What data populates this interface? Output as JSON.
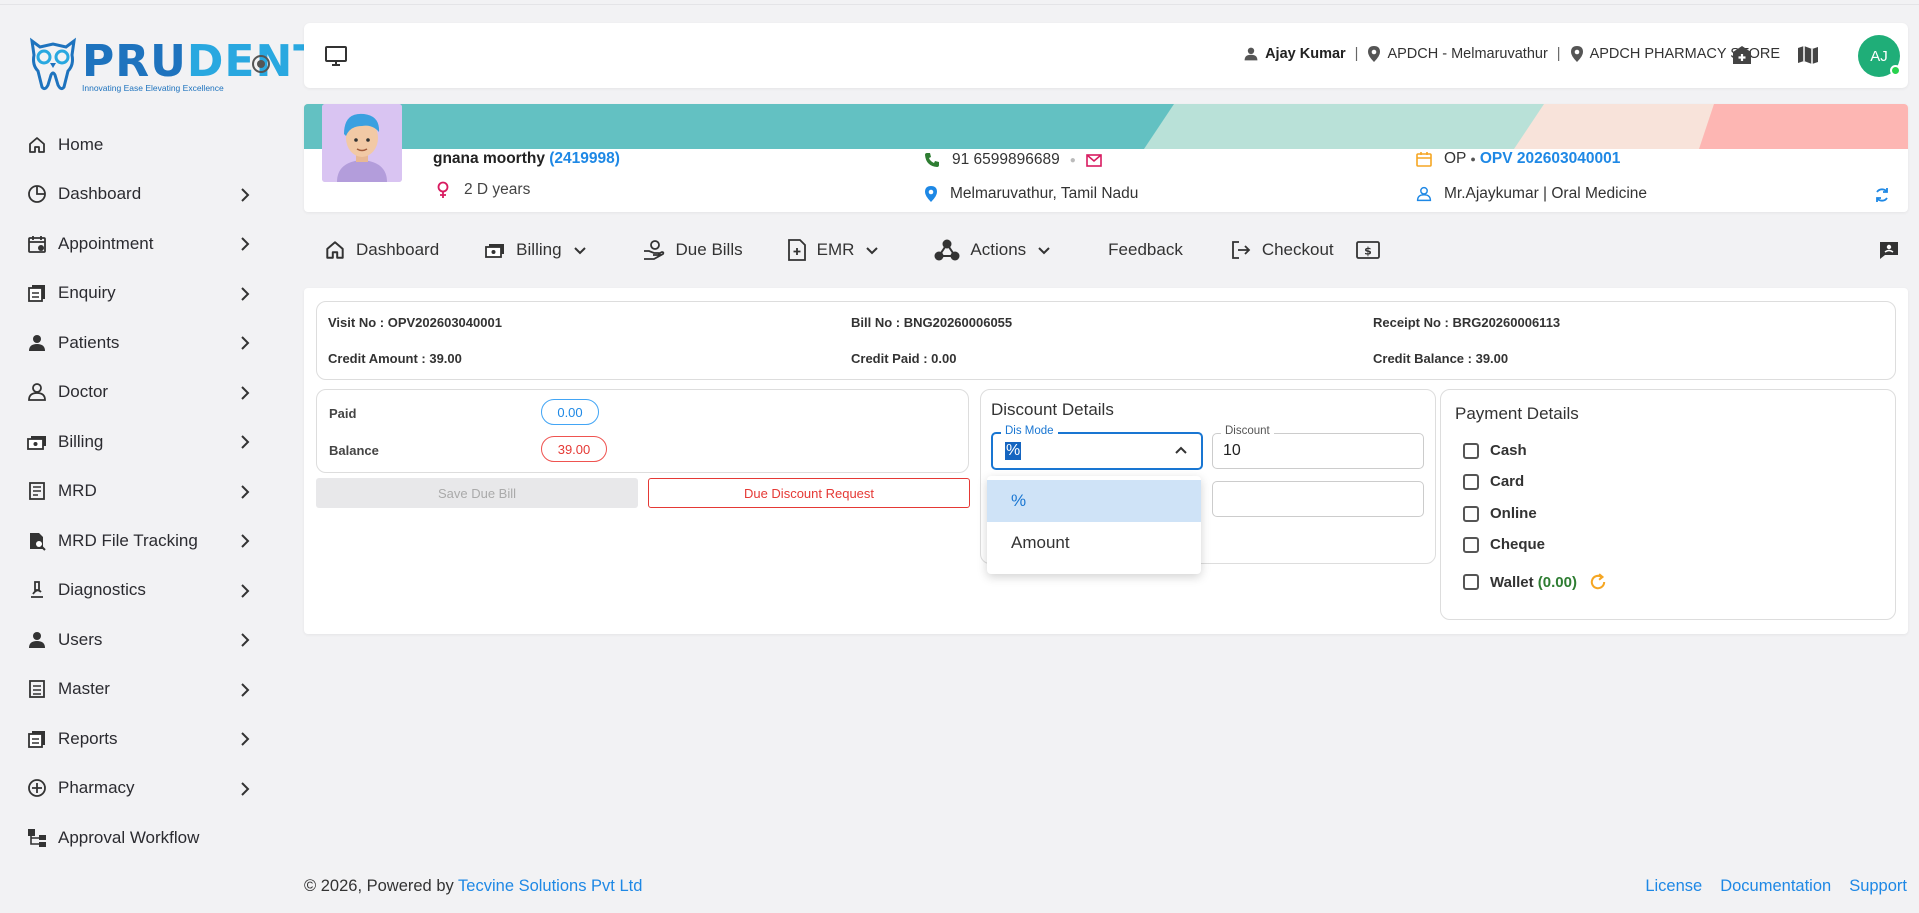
{
  "brand": {
    "word1": "PRU",
    "word2": "DENT",
    "tagline": "Innovating Ease Elevating Excellence"
  },
  "sidebar": {
    "items": [
      {
        "label": "Home",
        "icon": "home-icon",
        "chevron": false
      },
      {
        "label": "Dashboard",
        "icon": "pie-chart-icon",
        "chevron": true
      },
      {
        "label": "Appointment",
        "icon": "calendar-icon",
        "chevron": true
      },
      {
        "label": "Enquiry",
        "icon": "notes-icon",
        "chevron": true
      },
      {
        "label": "Patients",
        "icon": "person-icon",
        "chevron": true
      },
      {
        "label": "Doctor",
        "icon": "doctor-icon",
        "chevron": true
      },
      {
        "label": "Billing",
        "icon": "money-icon",
        "chevron": true
      },
      {
        "label": "MRD",
        "icon": "document-icon",
        "chevron": true
      },
      {
        "label": "MRD File Tracking",
        "icon": "file-search-icon",
        "chevron": true
      },
      {
        "label": "Diagnostics",
        "icon": "microscope-icon",
        "chevron": true
      },
      {
        "label": "Users",
        "icon": "person-icon",
        "chevron": true
      },
      {
        "label": "Master",
        "icon": "list-icon",
        "chevron": true
      },
      {
        "label": "Reports",
        "icon": "reports-icon",
        "chevron": true
      },
      {
        "label": "Pharmacy",
        "icon": "pharmacy-icon",
        "chevron": true
      },
      {
        "label": "Approval Workflow",
        "icon": "workflow-icon",
        "chevron": false
      }
    ]
  },
  "header": {
    "user": "Ajay Kumar",
    "location": "APDCH - Melmaruvathur",
    "store": "APDCH PHARMACY STORE",
    "avatar_initials": "AJ"
  },
  "patient": {
    "name": "gnana moorthy",
    "id": "(2419998)",
    "age": "2 D years",
    "phone": "91 6599896689",
    "address": "Melmaruvathur, Tamil Nadu",
    "visit_type": "OP",
    "visit_no": "OPV 202603040001",
    "doctor": "Mr.Ajaykumar | Oral Medicine"
  },
  "toolbar": {
    "dashboard": "Dashboard",
    "billing": "Billing",
    "due_bills": "Due Bills",
    "emr": "EMR",
    "actions": "Actions",
    "feedback": "Feedback",
    "checkout": "Checkout"
  },
  "bill_info": {
    "visit_no": "Visit No : OPV202603040001",
    "bill_no": "Bill No : BNG20260006055",
    "receipt_no": "Receipt No : BRG20260006113",
    "credit_amount": "Credit Amount : 39.00",
    "credit_paid": "Credit Paid : 0.00",
    "credit_balance": "Credit Balance : 39.00"
  },
  "payment_summary": {
    "paid_label": "Paid",
    "paid_value": "0.00",
    "balance_label": "Balance",
    "balance_value": "39.00"
  },
  "buttons": {
    "save_due_bill": "Save Due Bill",
    "due_discount_request": "Due Discount Request"
  },
  "discount": {
    "title": "Discount Details",
    "mode_label": "Dis Mode",
    "mode_value": "%",
    "discount_label": "Discount",
    "discount_value": "10",
    "options": [
      "%",
      "Amount"
    ]
  },
  "payment_details": {
    "title": "Payment Details",
    "methods": [
      "Cash",
      "Card",
      "Online",
      "Cheque"
    ],
    "wallet_label": "Wallet",
    "wallet_value": "(0.00)"
  },
  "footer": {
    "copyright": "© 2026, Powered by",
    "company": "Tecvine Solutions Pvt Ltd",
    "links": [
      "License",
      "Documentation",
      "Support"
    ]
  },
  "colors": {
    "primary": "#1e88e5",
    "band_teal": "#63c1c2",
    "band_mint": "#b9e1d8",
    "band_peach": "#f8e3da",
    "band_pink": "#fdb6b3",
    "danger": "#e53935",
    "success": "#2e7d32"
  }
}
